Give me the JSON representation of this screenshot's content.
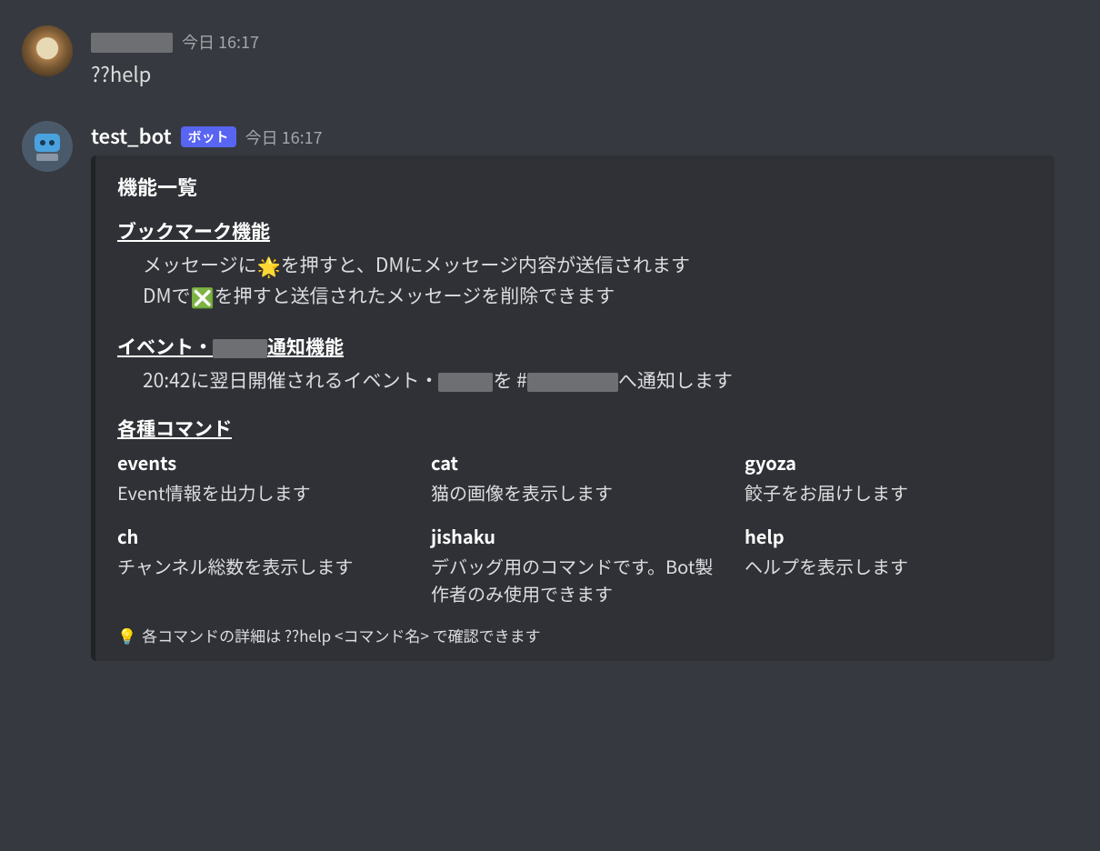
{
  "messages": {
    "user": {
      "redacted_name_placeholder": "██████",
      "timestamp": "今日 16:17",
      "content": "??help"
    },
    "bot": {
      "name": "test_bot",
      "tag": "ボット",
      "timestamp": "今日 16:17"
    }
  },
  "embed": {
    "title": "機能一覧",
    "sections": {
      "bookmark": {
        "title": "ブックマーク機能",
        "line1_a": "メッセージに",
        "line1_b": "を押すと、DMにメッセージ内容が送信されます",
        "line2_a": "DMで",
        "line2_b": "を押すと送信されたメッセージを削除できます"
      },
      "event": {
        "title_a": "イベント・",
        "title_b": "通知機能",
        "line_a": "20:42に翌日開催されるイベント・",
        "line_b": "を #",
        "line_c": "へ通知します"
      },
      "commands_title": "各種コマンド"
    },
    "fields": [
      {
        "name": "events",
        "value": "Event情報を出力します"
      },
      {
        "name": "cat",
        "value": "猫の画像を表示します"
      },
      {
        "name": "gyoza",
        "value": "餃子をお届けします"
      },
      {
        "name": "ch",
        "value": "チャンネル総数を表示します"
      },
      {
        "name": "jishaku",
        "value": "デバッグ用のコマンドです。Bot製作者のみ使用できます"
      },
      {
        "name": "help",
        "value": "ヘルプを表示します"
      }
    ],
    "footer": "各コマンドの詳細は ??help <コマンド名> で確認できます"
  },
  "icons": {
    "star": "🌟",
    "x": "❎",
    "bulb": "💡"
  }
}
